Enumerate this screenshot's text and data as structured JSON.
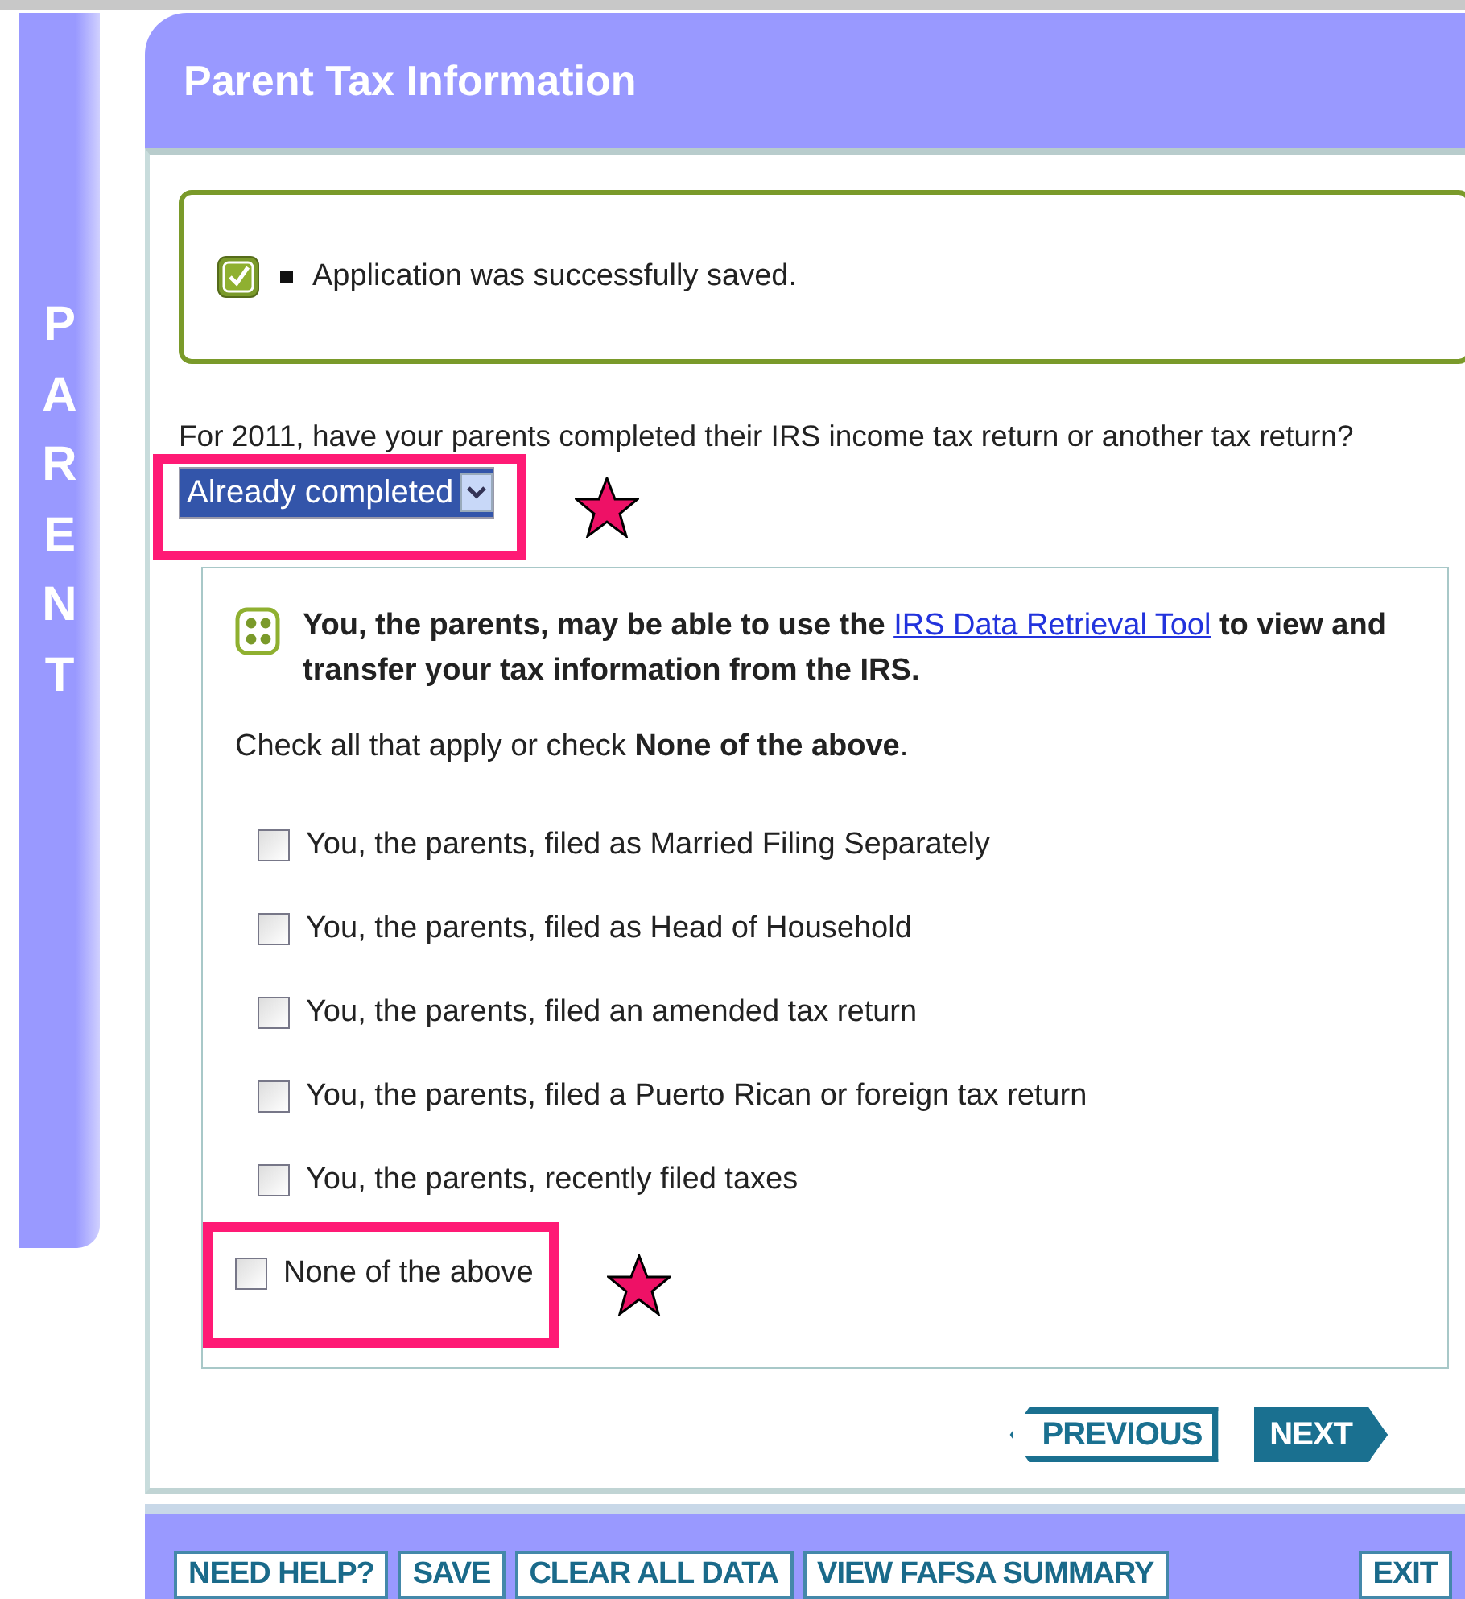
{
  "sidebar": {
    "label": "PARENT"
  },
  "header": {
    "title": "Parent Tax Information"
  },
  "save_notice": {
    "text": "Application was successfully saved."
  },
  "question": {
    "label": "For 2011, have your parents completed their IRS income tax return or another tax return?",
    "select": {
      "value": "Already completed",
      "highlighted": true
    }
  },
  "info": {
    "text_before": "You, the parents, may be able to use the ",
    "link": "IRS Data Retrieval Tool",
    "text_after": " to view and transfer your tax information from the IRS."
  },
  "instruction": "Check all that apply or check **None of the above**.",
  "options": [
    {
      "label": "You, the parents, filed as Married Filing Separately",
      "checked": false,
      "highlighted": false
    },
    {
      "label": "You, the parents, filed as Head of Household",
      "checked": false,
      "highlighted": false
    },
    {
      "label": "You, the parents, filed an amended tax return",
      "checked": false,
      "highlighted": false
    },
    {
      "label": "You, the parents, filed a Puerto Rican or foreign tax return",
      "checked": false,
      "highlighted": false
    },
    {
      "label": "You, the parents, recently filed taxes",
      "checked": false,
      "highlighted": false
    },
    {
      "label": "None of the above",
      "checked": false,
      "highlighted": true
    }
  ],
  "nav": {
    "previous": "PREVIOUS",
    "next": "NEXT"
  },
  "footer_buttons": [
    {
      "label": "NEED HELP?",
      "kind": "left"
    },
    {
      "label": "SAVE",
      "kind": "left"
    },
    {
      "label": "CLEAR ALL DATA",
      "kind": "left"
    },
    {
      "label": "VIEW FAFSA SUMMARY",
      "kind": "left"
    },
    {
      "label": "EXIT",
      "kind": "right"
    }
  ]
}
